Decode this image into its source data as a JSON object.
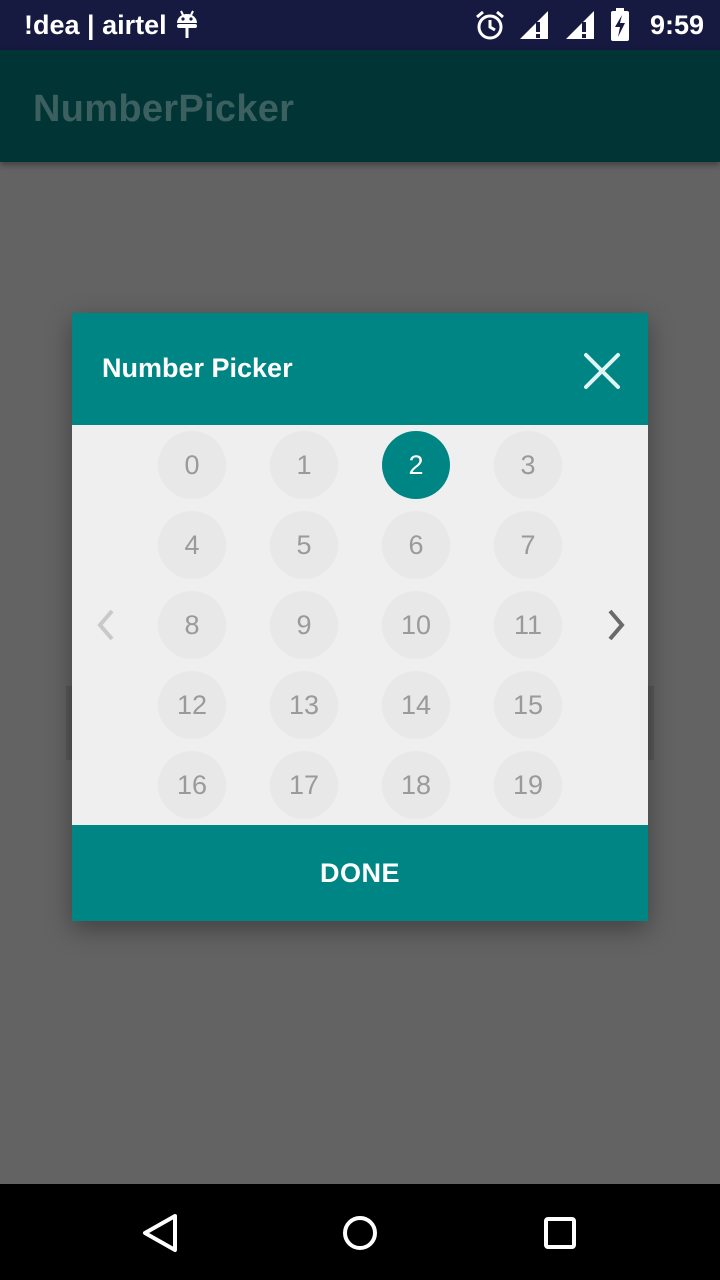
{
  "status_bar": {
    "carrier": "!dea | airtel",
    "time": "9:59",
    "icons": [
      "android-icon",
      "alarm-icon",
      "signal-icon",
      "signal-icon",
      "battery-charging-icon"
    ]
  },
  "app_bar": {
    "title": "NumberPicker"
  },
  "dialog": {
    "title": "Number Picker",
    "close_icon": "close-icon",
    "prev_icon": "chevron-left-icon",
    "next_icon": "chevron-right-icon",
    "numbers": [
      "0",
      "1",
      "2",
      "3",
      "4",
      "5",
      "6",
      "7",
      "8",
      "9",
      "10",
      "11",
      "12",
      "13",
      "14",
      "15",
      "16",
      "17",
      "18",
      "19"
    ],
    "selected": "2",
    "done_label": "DONE"
  },
  "colors": {
    "accent": "#008585",
    "status_bar": "#161940",
    "app_bar": "#003435",
    "scrim": "#636363"
  },
  "nav_bar": {
    "icons": [
      "back-icon",
      "home-icon",
      "recents-icon"
    ]
  }
}
